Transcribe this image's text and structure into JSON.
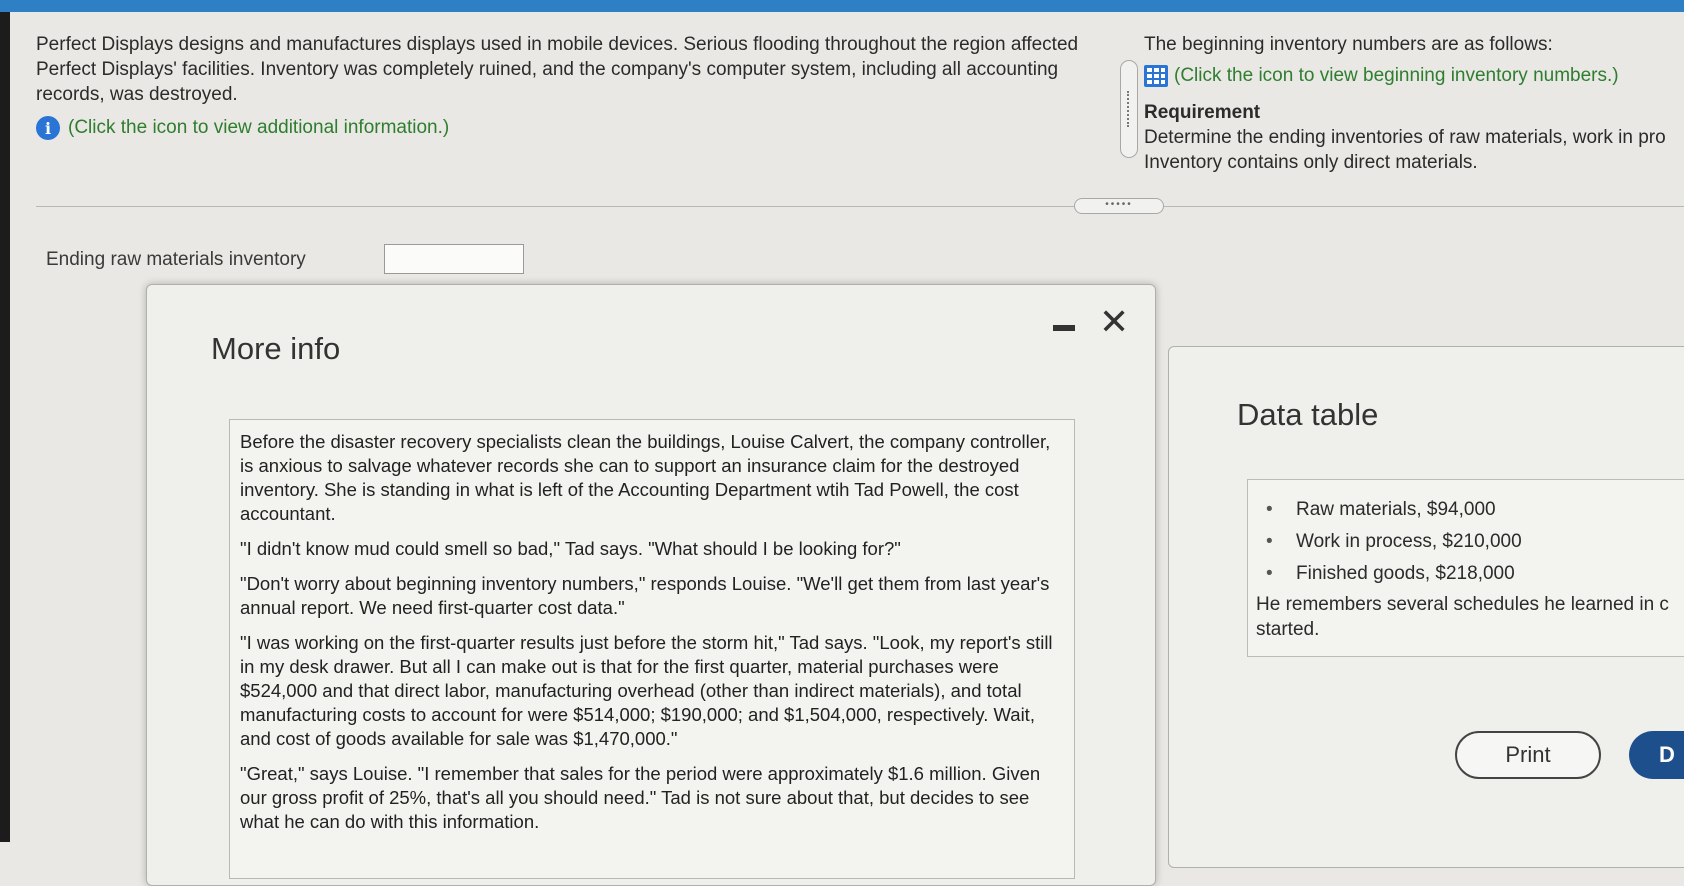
{
  "problem": {
    "text": "Perfect Displays designs and manufactures displays used in mobile devices. Serious flooding throughout the region affected Perfect Displays' facilities. Inventory was completely ruined, and the company's computer system, including all accounting records, was destroyed.",
    "info_link": "(Click the icon to view additional information.)"
  },
  "right_panel": {
    "beginning_text": "The beginning inventory numbers are as follows:",
    "beginning_link": "(Click the icon to view beginning inventory numbers.)",
    "requirement_title": "Requirement",
    "requirement_text": "Determine the ending inventories of raw materials, work in pro",
    "requirement_text2": "Inventory contains only direct materials."
  },
  "answer": {
    "ending_raw_label": "Ending raw materials inventory",
    "ending_raw_value": ""
  },
  "more_info": {
    "title": "More info",
    "paragraphs": [
      "Before the disaster recovery specialists clean the buildings, Louise Calvert, the company controller, is anxious to salvage whatever records she can to support an insurance claim for the destroyed inventory. She is standing in what is left of the Accounting Department wtih Tad Powell, the cost accountant.",
      "\"I didn't know mud could smell so bad,\" Tad says. \"What should I be looking for?\"",
      "\"Don't worry about beginning inventory numbers,\" responds Louise. \"We'll get them from last year's annual report. We need first-quarter cost data.\"",
      "\"I was working on the first-quarter results just before the storm hit,\" Tad says. \"Look, my report's still in my desk drawer. But all I can make out is that for the first quarter, material purchases were $524,000 and that direct labor, manufacturing overhead (other than indirect materials), and total manufacturing costs to account for were $514,000; $190,000; and $1,504,000, respectively. Wait, and cost of goods available for sale was $1,470,000.\"",
      "\"Great,\" says Louise. \"I remember that sales for the period were approximately $1.6 million. Given our gross profit of 25%, that's all you should need.\" Tad is not sure about that, but decides to see what he can do with this information."
    ]
  },
  "data_table": {
    "title": "Data table",
    "items": [
      "Raw materials, $94,000",
      "Work in process, $210,000",
      "Finished goods, $218,000"
    ],
    "note": "He remembers several schedules he learned in c",
    "note2": "started.",
    "print_label": "Print",
    "done_label": "D"
  },
  "colors": {
    "accent": "#2f7fc4",
    "link": "#2f7d2f",
    "button": "#1d4f8c"
  }
}
